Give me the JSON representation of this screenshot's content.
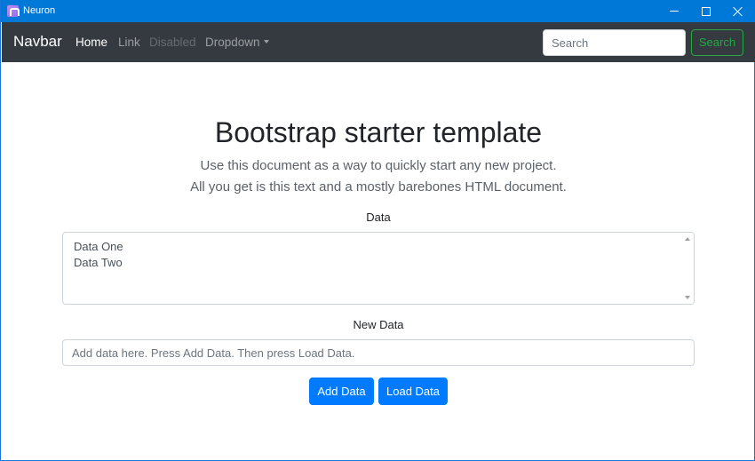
{
  "window": {
    "title": "Neuron",
    "icon": "neuron-app-icon",
    "controls": [
      "minimize-icon",
      "maximize-icon",
      "close-icon"
    ]
  },
  "navbar": {
    "brand": "Navbar",
    "links": {
      "home": "Home",
      "link": "Link",
      "disabled": "Disabled",
      "dropdown": "Dropdown"
    },
    "search": {
      "placeholder": "Search",
      "button_label": "Search"
    }
  },
  "main": {
    "title": "Bootstrap starter template",
    "lead_line1": "Use this document as a way to quickly start any new project.",
    "lead_line2": "All you get is this text and a mostly barebones HTML document.",
    "data_label": "Data",
    "data_items": [
      "Data One",
      "Data Two"
    ],
    "new_data_label": "New Data",
    "new_data_placeholder": "Add data here. Press Add Data. Then press Load Data.",
    "add_button": "Add Data",
    "load_button": "Load Data"
  },
  "colors": {
    "titlebar": "#0078d7",
    "navbar": "#343a40",
    "primary": "#007bff",
    "success": "#28a745"
  }
}
